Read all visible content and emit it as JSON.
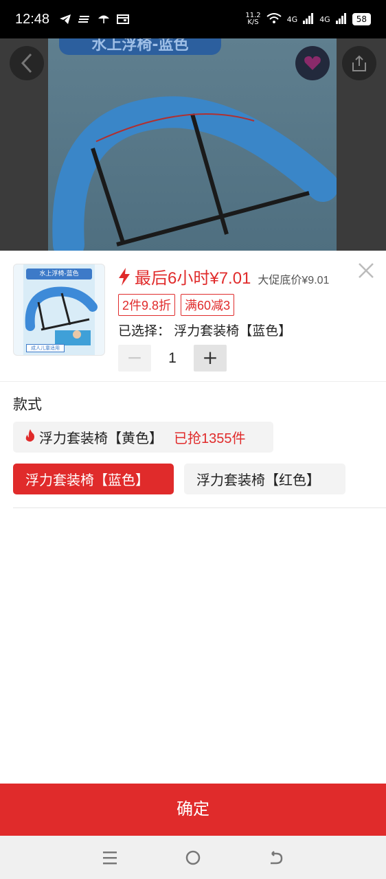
{
  "status_bar": {
    "time": "12:48",
    "net_speed_value": "11.2",
    "net_speed_unit": "K/S",
    "net1": "4G",
    "net2": "4G",
    "battery": "58"
  },
  "hero": {
    "banner_text": "水上浮椅-蓝色"
  },
  "product": {
    "thumb_title": "水上浮椅-蓝色",
    "thumb_label": "成人儿童适用",
    "price_text": "最后6小时¥7.01",
    "ref_price": "大促底价¥9.01",
    "tags": [
      "2件9.8折",
      "满60减3"
    ],
    "selected_label": "已选择：",
    "selected_value": "浮力套装椅【蓝色】",
    "quantity": "1",
    "minus": "−",
    "plus": "+"
  },
  "section": {
    "title": "款式",
    "options": [
      {
        "label": "浮力套装椅【黄色】",
        "sold": "已抢1355件",
        "hot": true
      },
      {
        "label": "浮力套装椅【蓝色】",
        "selected": true
      },
      {
        "label": "浮力套装椅【红色】"
      }
    ]
  },
  "confirm_label": "确定",
  "colors": {
    "accent": "#e02b2b",
    "option_bg": "#f3f3f3"
  },
  "icons": [
    "back-icon",
    "favorite-icon",
    "share-icon",
    "close-icon",
    "flash-icon",
    "fire-icon",
    "menu-icon",
    "home-icon",
    "return-icon"
  ]
}
